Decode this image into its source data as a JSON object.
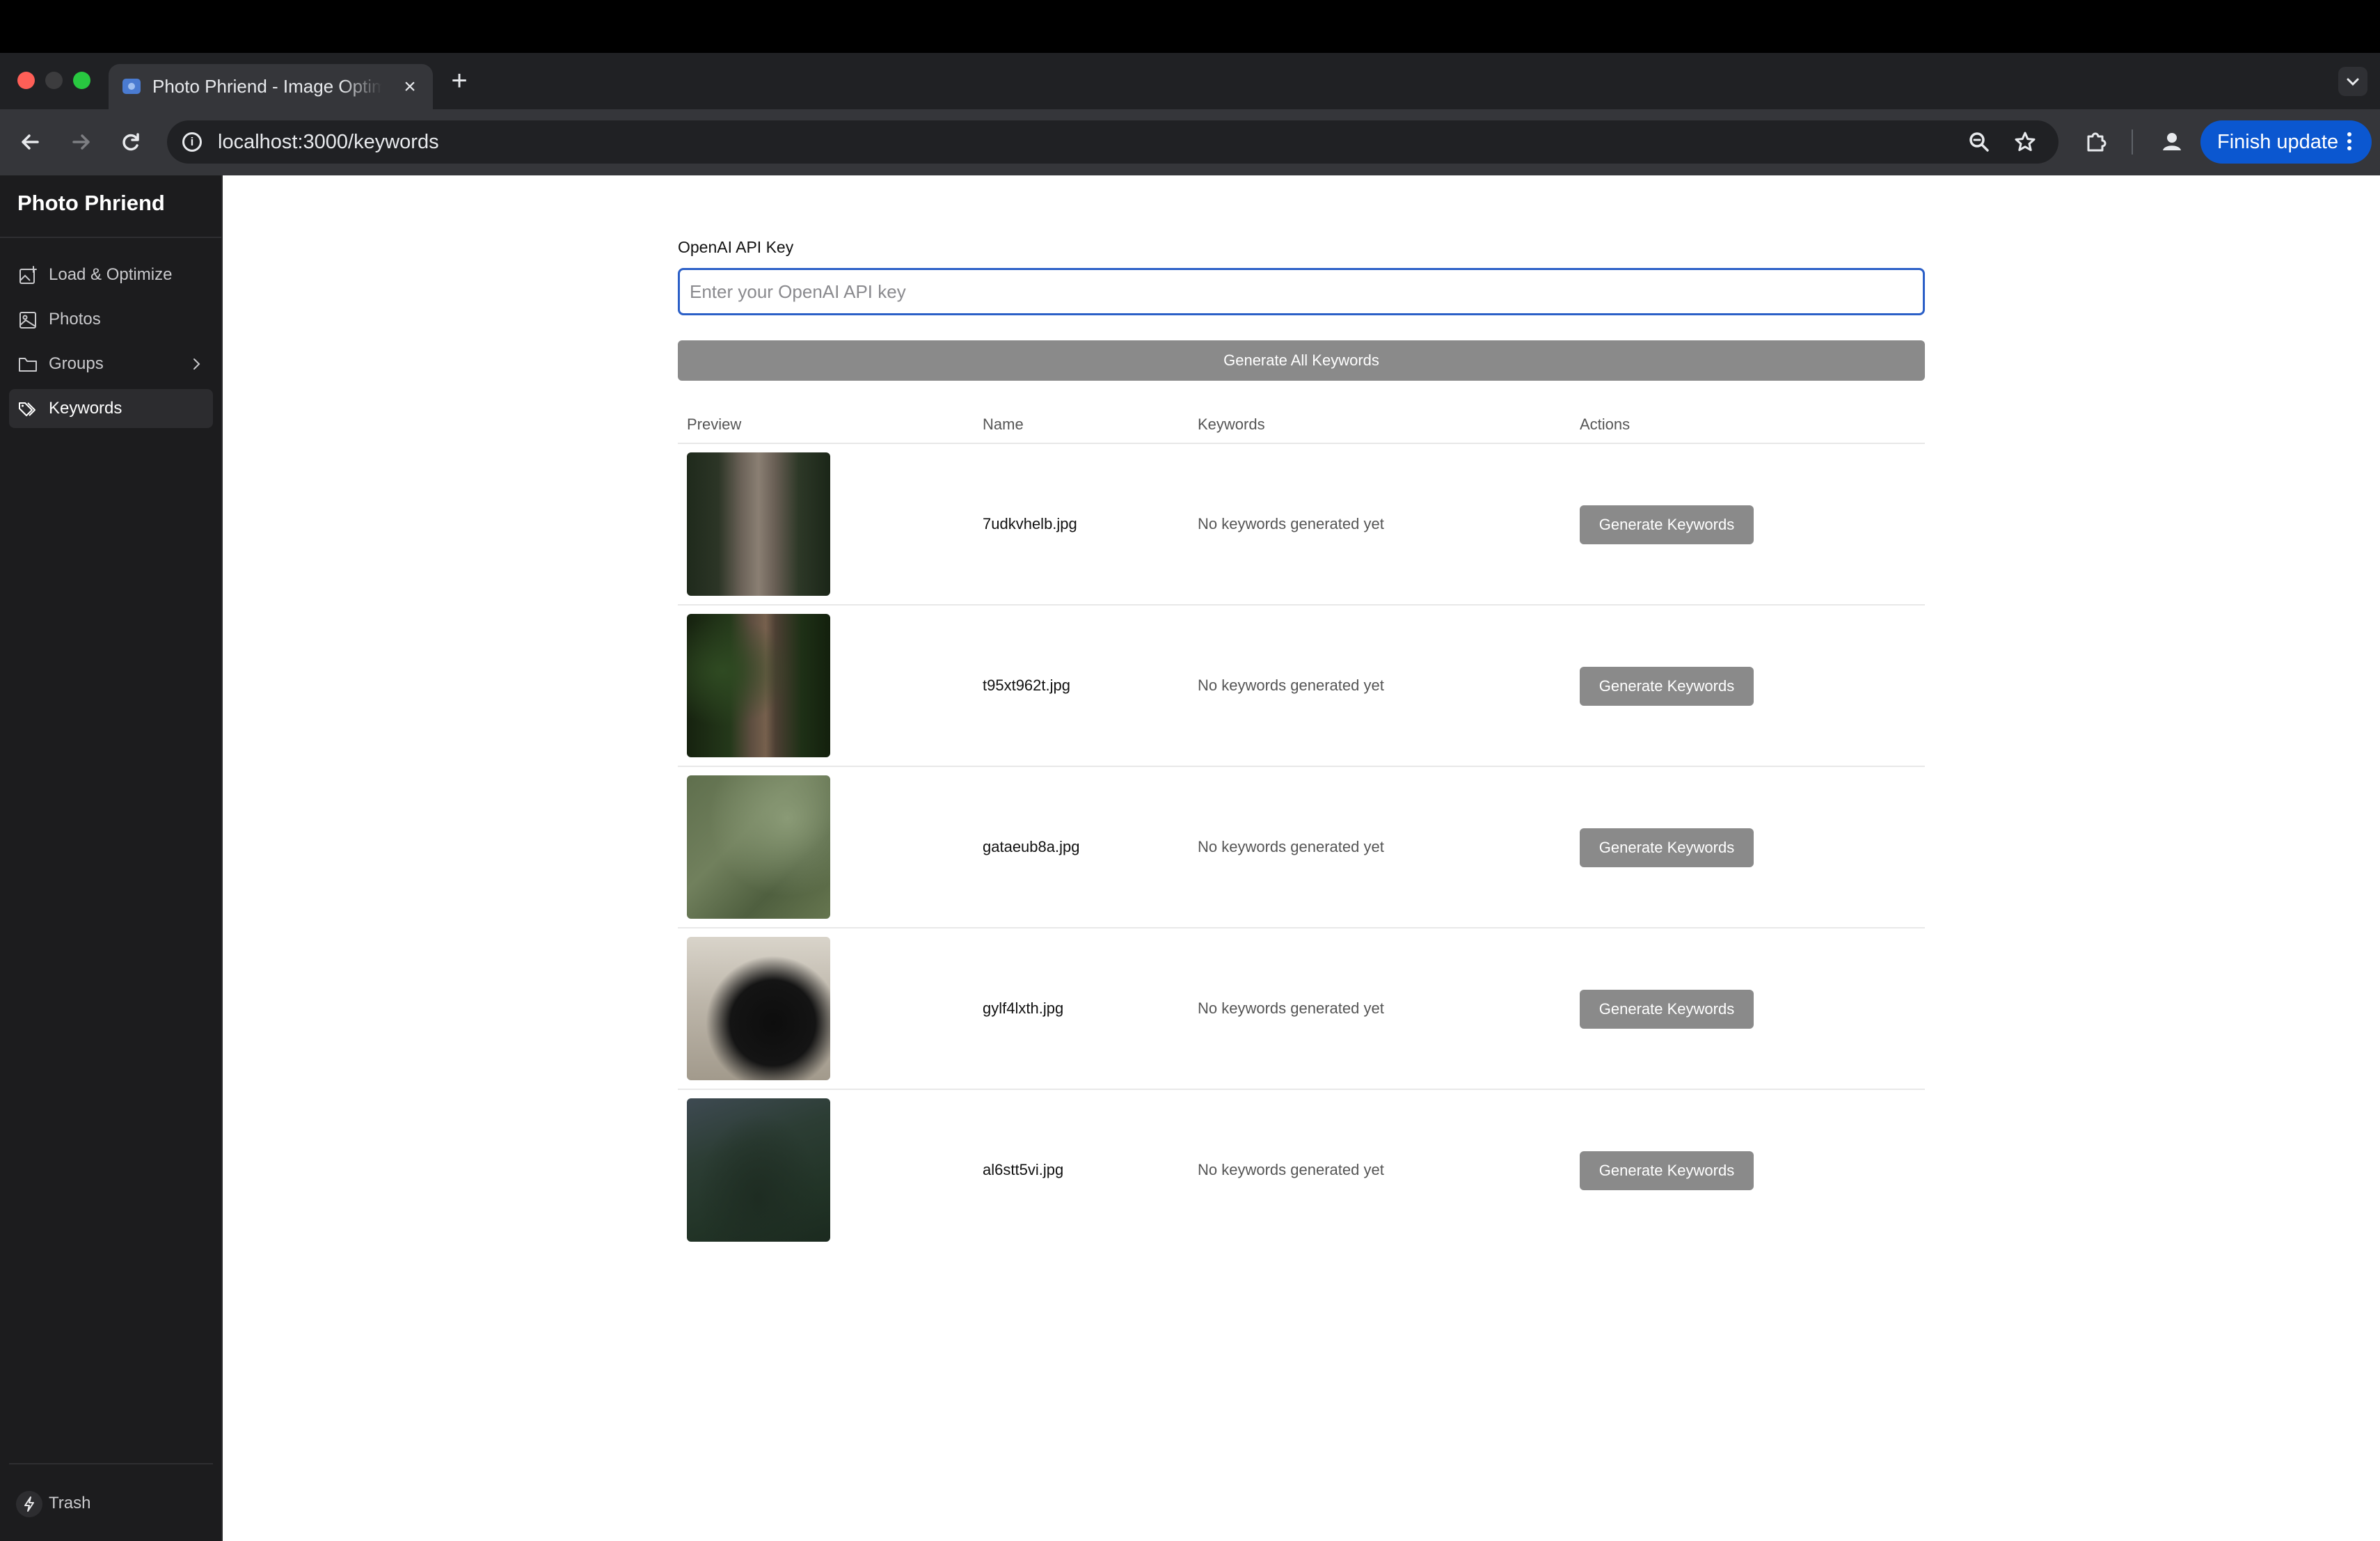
{
  "browser": {
    "tab_title": "Photo Phriend - Image Optimizer",
    "url": "localhost:3000/keywords",
    "finish_update_label": "Finish update"
  },
  "sidebar": {
    "app_title": "Photo Phriend",
    "items": [
      {
        "label": "Load & Optimize",
        "icon": "image-plus-icon"
      },
      {
        "label": "Photos",
        "icon": "image-icon"
      },
      {
        "label": "Groups",
        "icon": "folder-icon"
      },
      {
        "label": "Keywords",
        "icon": "tags-icon",
        "active": true
      }
    ],
    "trash_label": "Trash"
  },
  "main": {
    "api_key_label": "OpenAI API Key",
    "api_key_placeholder": "Enter your OpenAI API key",
    "api_key_value": "",
    "generate_all_label": "Generate All Keywords",
    "columns": [
      "Preview",
      "Name",
      "Keywords",
      "Actions"
    ],
    "rows": [
      {
        "name": "7udkvhelb.jpg",
        "keywords": "No keywords generated yet",
        "action": "Generate Keywords"
      },
      {
        "name": "t95xt962t.jpg",
        "keywords": "No keywords generated yet",
        "action": "Generate Keywords"
      },
      {
        "name": "gataeub8a.jpg",
        "keywords": "No keywords generated yet",
        "action": "Generate Keywords"
      },
      {
        "name": "gylf4lxth.jpg",
        "keywords": "No keywords generated yet",
        "action": "Generate Keywords"
      },
      {
        "name": "al6stt5vi.jpg",
        "keywords": "No keywords generated yet",
        "action": "Generate Keywords"
      }
    ]
  },
  "colors": {
    "accent": "#0b57d0",
    "button_gray": "#8a8a8a",
    "sidebar_bg": "#1c1c1e",
    "input_focus": "#2b5fc7"
  }
}
